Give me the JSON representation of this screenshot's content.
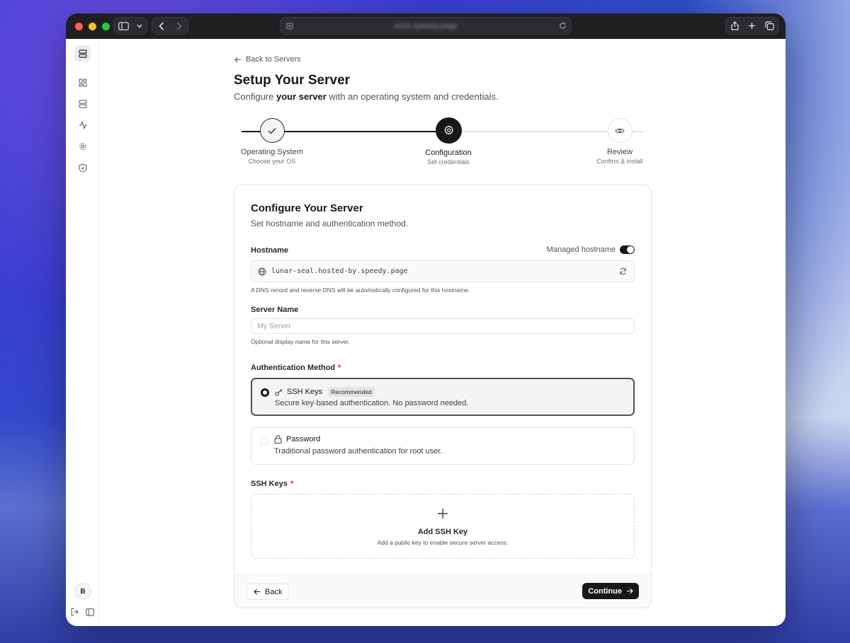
{
  "browser": {
    "url": "ortch.speedy.page"
  },
  "sidebar": {
    "avatar_initial": "B"
  },
  "header": {
    "back_link": "Back to Servers",
    "title": "Setup Your Server",
    "subtitle_pre": "Configure ",
    "subtitle_bold": "your server",
    "subtitle_post": " with an operating system and credentials."
  },
  "steps": [
    {
      "label": "Operating System",
      "desc": "Choose your OS",
      "state": "completed"
    },
    {
      "label": "Configuration",
      "desc": "Set credentials",
      "state": "active"
    },
    {
      "label": "Review",
      "desc": "Confirm & install",
      "state": "pending"
    }
  ],
  "card": {
    "title": "Configure Your Server",
    "subtitle": "Set hostname and authentication method.",
    "hostname": {
      "label": "Hostname",
      "managed_label": "Managed hostname",
      "managed_enabled": true,
      "value": "lunar-seal.hosted-by.speedy.page",
      "help": "A DNS record and reverse DNS will be automatically configured for this hostname."
    },
    "server_name": {
      "label": "Server Name",
      "placeholder": "My Server",
      "value": "",
      "help": "Optional display name for this server."
    },
    "auth": {
      "label": "Authentication Method",
      "required_mark": "*",
      "options": [
        {
          "title": "SSH Keys",
          "badge": "Recommended",
          "desc": "Secure key-based authentication. No password needed.",
          "selected": true,
          "icon": "key-icon"
        },
        {
          "title": "Password",
          "badge": "",
          "desc": "Traditional password authentication for root user.",
          "selected": false,
          "icon": "lock-icon"
        }
      ]
    },
    "ssh_keys": {
      "label": "SSH Keys",
      "required_mark": "*",
      "add_title": "Add SSH Key",
      "add_desc": "Add a public key to enable secure server access."
    },
    "footer": {
      "back_label": "Back",
      "continue_label": "Continue"
    }
  },
  "colors": {
    "primary": "#18181b",
    "required": "#dc2626",
    "border": "#e4e4e7"
  }
}
